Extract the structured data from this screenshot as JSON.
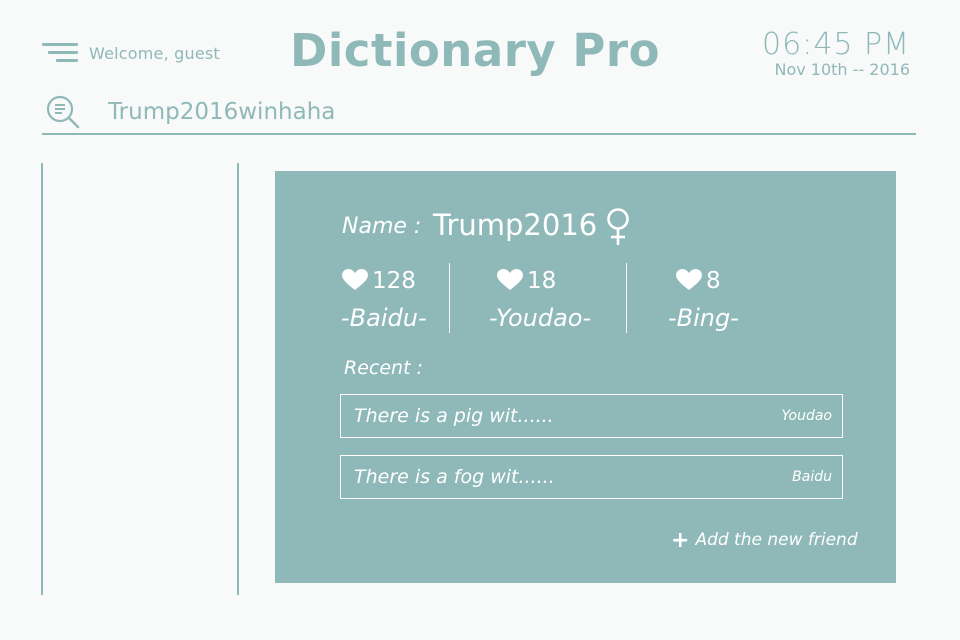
{
  "header": {
    "welcome": "Welcome, guest",
    "title": "Dictionary Pro",
    "time": "06:45 PM",
    "date": "Nov 10th -- 2016"
  },
  "search": {
    "value": "Trump2016winhaha"
  },
  "profile": {
    "name_label": "Name :",
    "name": "Trump2016",
    "gender_icon": "female-icon",
    "stats": [
      {
        "count": "128",
        "source": "-Baidu-"
      },
      {
        "count": "18",
        "source": "-Youdao-"
      },
      {
        "count": "8",
        "source": "-Bing-"
      }
    ],
    "recent_label": "Recent :",
    "recent": [
      {
        "text": "There is a pig wit......",
        "source": "Youdao"
      },
      {
        "text": "There is a fog wit......",
        "source": "Baidu"
      }
    ],
    "add_friend_label": "Add the new friend"
  },
  "colors": {
    "accent": "#8fb9b8",
    "background": "#f8f9f9",
    "card_text": "#ffffff"
  }
}
